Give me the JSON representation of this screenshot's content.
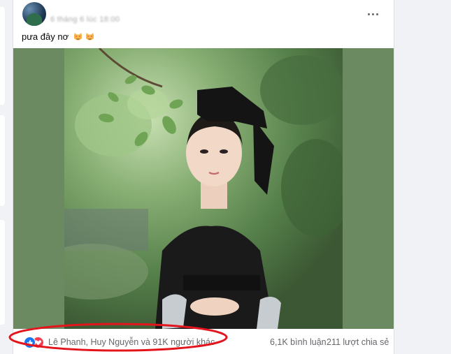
{
  "post": {
    "timestamp": "6 tháng 6 lúc 18:00",
    "text": "pưa đây nơ",
    "emojis": [
      "cat-face-heart-eyes",
      "cat-face-heart-eyes"
    ],
    "photo_alt": "Cô gái mặc áo dân tộc màu đen đứng giữa cây xanh"
  },
  "reactions": {
    "types": [
      "like",
      "love"
    ],
    "names_text": "Lê Phanh, Huy Nguyễn và 91K người khác",
    "comments_text": "6,1K bình luận",
    "shares_text": "211 lượt chia sẻ"
  },
  "colors": {
    "background": "#f0f2f5",
    "card": "#ffffff",
    "photo_padding": "#6b8a62",
    "like_blue": "#1877f2",
    "love_red": "#f33e58",
    "annotation_red": "#e4141c",
    "secondary_text": "#65676b"
  }
}
